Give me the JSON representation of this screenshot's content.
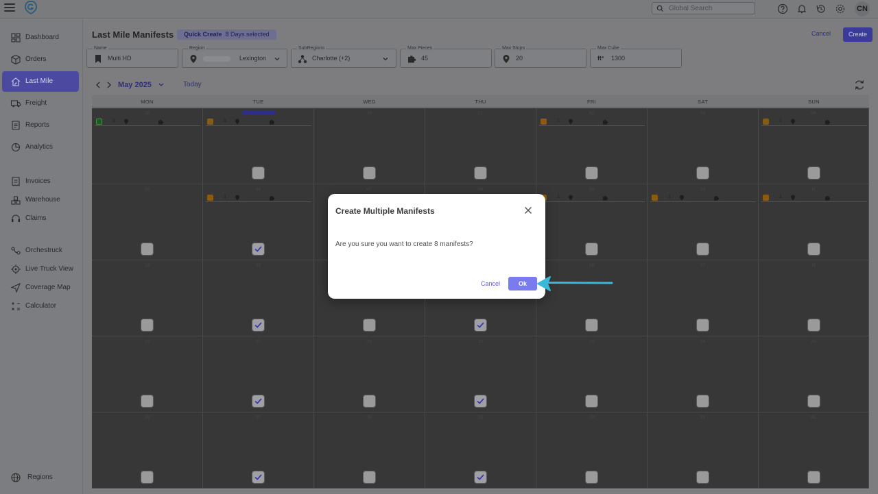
{
  "topbar": {
    "search_placeholder": "Global Search",
    "avatar_initials": "CN"
  },
  "sidebar": {
    "items": [
      {
        "label": "Dashboard",
        "icon": "dashboard-icon"
      },
      {
        "label": "Orders",
        "icon": "box-icon"
      },
      {
        "label": "Last Mile",
        "icon": "house-route-icon",
        "active": true
      },
      {
        "label": "Freight",
        "icon": "truck-icon"
      },
      {
        "label": "Reports",
        "icon": "report-icon"
      },
      {
        "label": "Analytics",
        "icon": "analytics-icon"
      },
      {
        "label": "Invoices",
        "icon": "invoice-icon"
      },
      {
        "label": "Warehouse",
        "icon": "warehouse-icon"
      },
      {
        "label": "Claims",
        "icon": "headset-icon"
      },
      {
        "label": "Orchestruck",
        "icon": "orchestruck-icon"
      },
      {
        "label": "Live Truck View",
        "icon": "location-target-icon"
      },
      {
        "label": "Coverage Map",
        "icon": "send-icon"
      },
      {
        "label": "Calculator",
        "icon": "calculator-icon"
      },
      {
        "label": "Regions",
        "icon": "globe-icon"
      }
    ]
  },
  "header": {
    "title": "Last Mile Manifests",
    "quick_create_label": "Quick Create",
    "quick_create_count": "8 Days selected",
    "cancel_label": "Cancel",
    "create_label": "Create"
  },
  "filters": {
    "name": {
      "label": "Name",
      "value": "Multi HD"
    },
    "region": {
      "label": "Region",
      "value": "Lexington"
    },
    "subregions": {
      "label": "SubRegions",
      "value": "Charlotte (+2)"
    },
    "max_pieces": {
      "label": "Max Pieces",
      "value": "45"
    },
    "max_stops": {
      "label": "Max Stops",
      "value": "20"
    },
    "max_cube": {
      "label": "Max Cube",
      "value": "1300",
      "unit": "ft³"
    }
  },
  "calendar": {
    "month": "May 2025",
    "today_label": "Today",
    "weekdays": [
      "MON",
      "TUE",
      "WED",
      "THU",
      "FRI",
      "SAT",
      "SUN"
    ],
    "weeks": [
      [
        {
          "day": "28",
          "checked": null,
          "info": {
            "badge": "green",
            "c1": "3",
            "c2": "0",
            "c3": "15"
          }
        },
        {
          "day": "",
          "checked": false,
          "today": true,
          "info": {
            "badge": "orange",
            "c1": "1",
            "c2": "0",
            "c3": "0"
          }
        },
        {
          "day": "30",
          "checked": false
        },
        {
          "day": "01",
          "checked": false
        },
        {
          "day": "02",
          "checked": false,
          "info": {
            "badge": "orange",
            "c1": "1",
            "c2": "0",
            "c3": "0"
          }
        },
        {
          "day": "03",
          "checked": false
        },
        {
          "day": "04",
          "checked": false,
          "info": {
            "badge": "orange",
            "c1": "1",
            "c2": "0",
            "c3": "0"
          }
        }
      ],
      [
        {
          "day": "05",
          "checked": false
        },
        {
          "day": "06",
          "checked": true,
          "info": {
            "badge": "orange",
            "c1": "1",
            "c2": "0",
            "c3": "0"
          }
        },
        {
          "day": "07",
          "checked": false
        },
        {
          "day": "08",
          "checked": false
        },
        {
          "day": "09",
          "checked": false,
          "info": {
            "badge": "orange",
            "c1": "1",
            "c2": "0",
            "c3": "0"
          }
        },
        {
          "day": "10",
          "checked": false,
          "info": {
            "badge": "orange",
            "c1": "1",
            "c2": "0",
            "c3": "0"
          }
        },
        {
          "day": "11",
          "checked": false,
          "info": {
            "badge": "orange",
            "c1": "1",
            "c2": "0",
            "c3": "0"
          }
        }
      ],
      [
        {
          "day": "12",
          "checked": false
        },
        {
          "day": "13",
          "checked": true
        },
        {
          "day": "14",
          "checked": false
        },
        {
          "day": "15",
          "checked": true
        },
        {
          "day": "16",
          "checked": false
        },
        {
          "day": "17",
          "checked": false
        },
        {
          "day": "18",
          "checked": false
        }
      ],
      [
        {
          "day": "19",
          "checked": false
        },
        {
          "day": "20",
          "checked": true
        },
        {
          "day": "21",
          "checked": false
        },
        {
          "day": "22",
          "checked": true
        },
        {
          "day": "23",
          "checked": false
        },
        {
          "day": "24",
          "checked": false
        },
        {
          "day": "25",
          "checked": false
        }
      ],
      [
        {
          "day": "26",
          "checked": false
        },
        {
          "day": "27",
          "checked": true
        },
        {
          "day": "28",
          "checked": false
        },
        {
          "day": "29",
          "checked": true
        },
        {
          "day": "30",
          "checked": false
        },
        {
          "day": "31",
          "checked": false
        },
        {
          "day": "01",
          "checked": false
        }
      ]
    ]
  },
  "modal": {
    "title": "Create Multiple Manifests",
    "message": "Are you sure you want to create 8 manifests?",
    "cancel_label": "Cancel",
    "ok_label": "Ok"
  },
  "colors": {
    "accent": "#7b7bf0",
    "arrow": "#3bb8d8"
  }
}
